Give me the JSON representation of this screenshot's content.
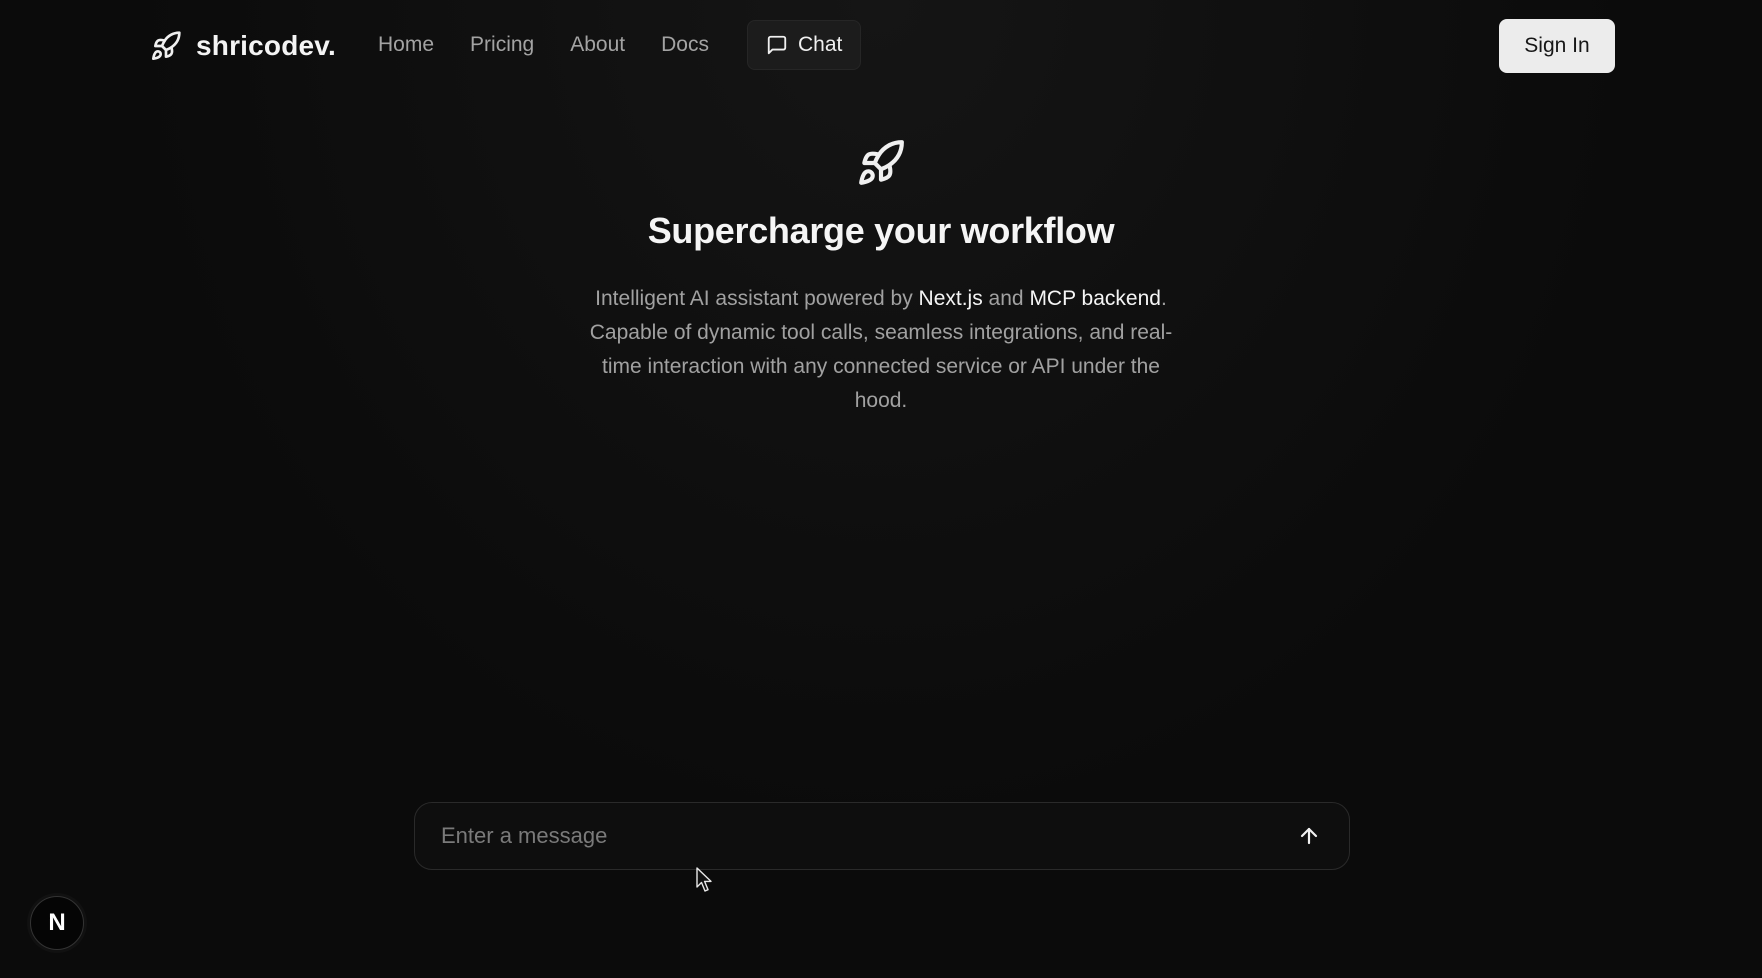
{
  "header": {
    "brand_name": "shricodev.",
    "nav": [
      "Home",
      "Pricing",
      "About",
      "Docs"
    ],
    "chat_label": "Chat",
    "signin_label": "Sign In"
  },
  "hero": {
    "title": "Supercharge your workflow",
    "desc_part1": "Intelligent AI assistant powered by ",
    "desc_strong1": "Next.js",
    "desc_part2": " and ",
    "desc_strong2": "MCP backend",
    "desc_part3": ". Capable of dynamic tool calls, seamless integrations, and real-time interaction with any connected service or API under the hood."
  },
  "composer": {
    "placeholder": "Enter a message",
    "value": ""
  },
  "badge": {
    "letter": "N"
  },
  "icons": {
    "brand": "rocket-icon",
    "hero": "rocket-icon",
    "chat": "message-square-icon",
    "send": "arrow-up-icon"
  },
  "colors": {
    "background": "#0b0b0b",
    "text_primary": "#f5f5f5",
    "text_muted": "#a1a1a1",
    "signin_bg": "#ececec"
  }
}
